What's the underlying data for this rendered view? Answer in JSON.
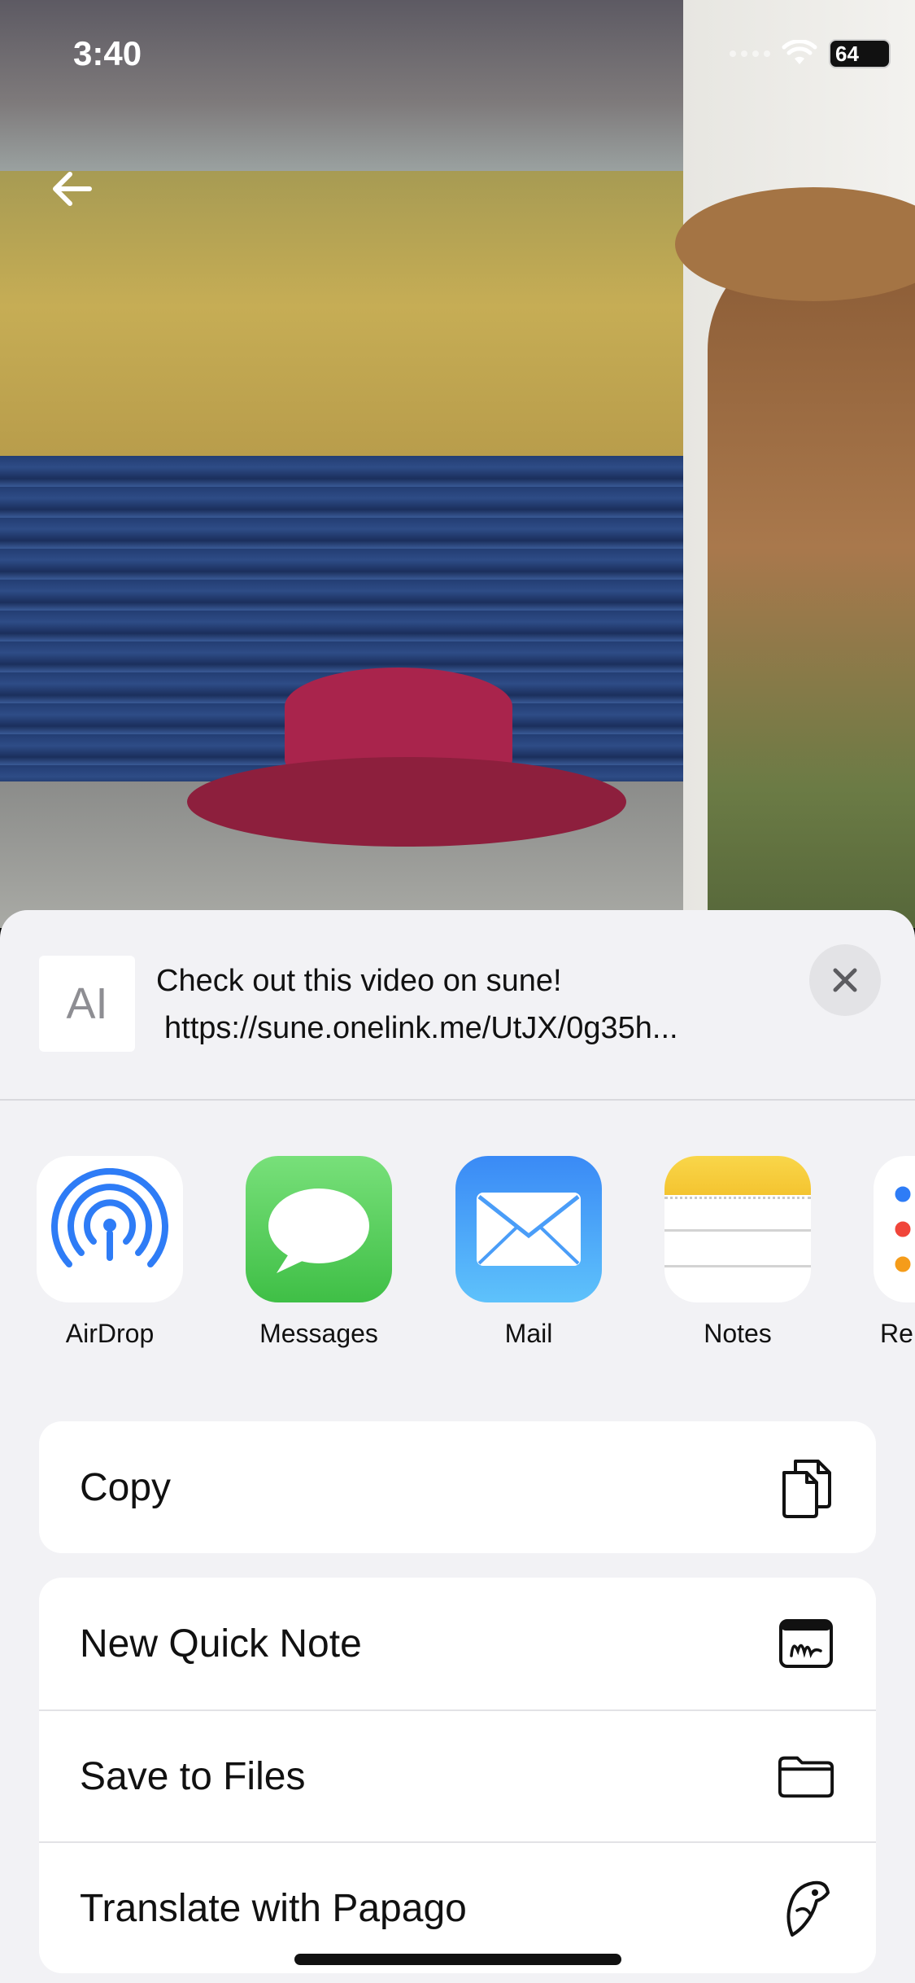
{
  "status": {
    "time": "3:40",
    "battery": "64"
  },
  "share_preview": {
    "title": "Check out this video on sune!",
    "url": "https://sune.onelink.me/UtJX/0g35h...",
    "thumb_glyph": "AI"
  },
  "apps": [
    {
      "label": "AirDrop",
      "icon": "airdrop-icon"
    },
    {
      "label": "Messages",
      "icon": "messages-icon"
    },
    {
      "label": "Mail",
      "icon": "mail-icon"
    },
    {
      "label": "Notes",
      "icon": "notes-icon"
    },
    {
      "label": "Rer",
      "icon": "reminders-icon"
    }
  ],
  "actions": {
    "copy": {
      "label": "Copy",
      "icon": "copy-icon"
    },
    "quick_note": {
      "label": "New Quick Note",
      "icon": "quick-note-icon"
    },
    "save_files": {
      "label": "Save to Files",
      "icon": "folder-icon"
    },
    "papago": {
      "label": "Translate with Papago",
      "icon": "papago-icon"
    }
  }
}
